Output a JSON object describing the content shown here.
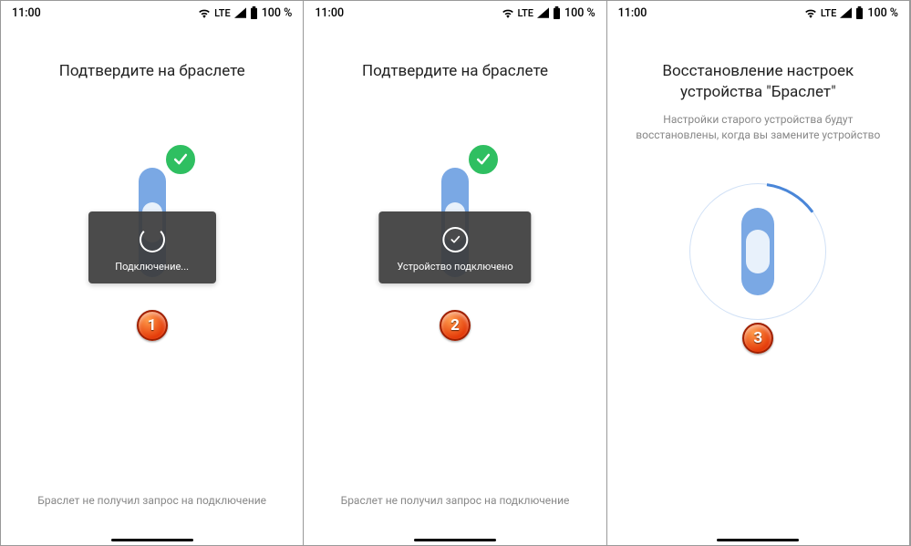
{
  "statusbar": {
    "time": "11:00",
    "network": "LTE",
    "battery_pct": "100 %"
  },
  "screens": [
    {
      "title": "Подтвердите на браслете",
      "toast": "Подключение...",
      "toast_state": "loading",
      "bottom_link": "Браслет не получил запрос на подключение",
      "annotation": "1"
    },
    {
      "title": "Подтвердите на браслете",
      "toast": "Устройство подключено",
      "toast_state": "done",
      "bottom_link": "Браслет не получил запрос на подключение",
      "annotation": "2"
    },
    {
      "title": "Восстановление настроек устройства \"Браслет\"",
      "subtitle": "Настройки старого устройства будут восстановлены, когда вы замените устройство",
      "annotation": "3"
    }
  ]
}
